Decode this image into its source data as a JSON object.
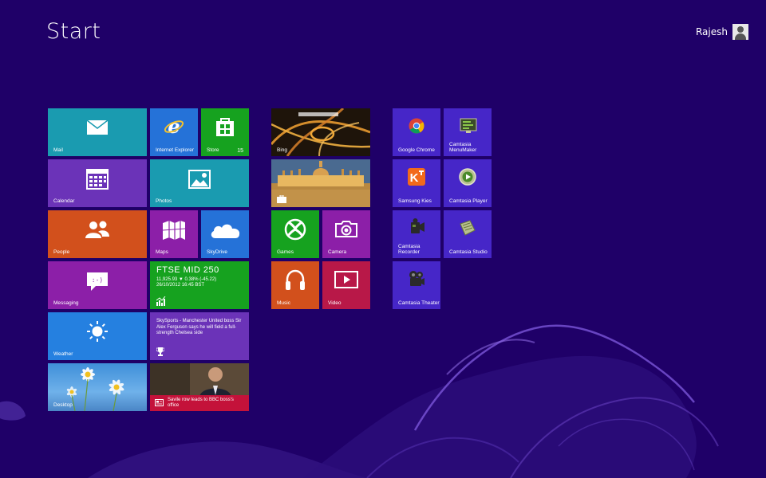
{
  "header": {
    "title": "Start",
    "user_name": "Rajesh"
  },
  "tiles": {
    "mail": {
      "label": "Mail"
    },
    "ie": {
      "label": "Internet Explorer"
    },
    "store": {
      "label": "Store",
      "badge": "15"
    },
    "calendar": {
      "label": "Calendar"
    },
    "photos": {
      "label": "Photos"
    },
    "people": {
      "label": "People"
    },
    "maps": {
      "label": "Maps"
    },
    "skydrive": {
      "label": "SkyDrive"
    },
    "messaging": {
      "label": "Messaging"
    },
    "finance": {
      "title": "FTSE MID 250",
      "line1": "11,925.93  ▼  0.38% (-45.22)",
      "line2": "26/10/2012 16:45 BST"
    },
    "weather": {
      "label": "Weather"
    },
    "sport": {
      "text": "SkySports - Manchester United boss Sir Alex Ferguson says he will field a full-strength Chelsea side"
    },
    "desktop": {
      "label": "Desktop"
    },
    "news": {
      "text": "Savile row leads to BBC boss's office"
    },
    "bing": {
      "label": "Bing"
    },
    "travel": {
      "label": ""
    },
    "games": {
      "label": "Games"
    },
    "camera": {
      "label": "Camera"
    },
    "music": {
      "label": "Music"
    },
    "video": {
      "label": "Video"
    },
    "chrome": {
      "label": "Google Chrome"
    },
    "camtasia_menumaker": {
      "label": "Camtasia MenuMaker"
    },
    "samsung_kies": {
      "label": "Samsung Kies"
    },
    "camtasia_player": {
      "label": "Camtasia Player"
    },
    "camtasia_recorder": {
      "label": "Camtasia Recorder"
    },
    "camtasia_studio": {
      "label": "Camtasia Studio"
    },
    "camtasia_theater": {
      "label": "Camtasia Theater"
    }
  },
  "colors": {
    "background": "#1f0068",
    "teal": "#1a9bb0",
    "purple": "#6b33b8",
    "blue": "#2572d8",
    "orange": "#d2501c",
    "magenta": "#8c1fa8",
    "green": "#16a21f",
    "red": "#b81848",
    "app_blue": "#4626c8"
  }
}
